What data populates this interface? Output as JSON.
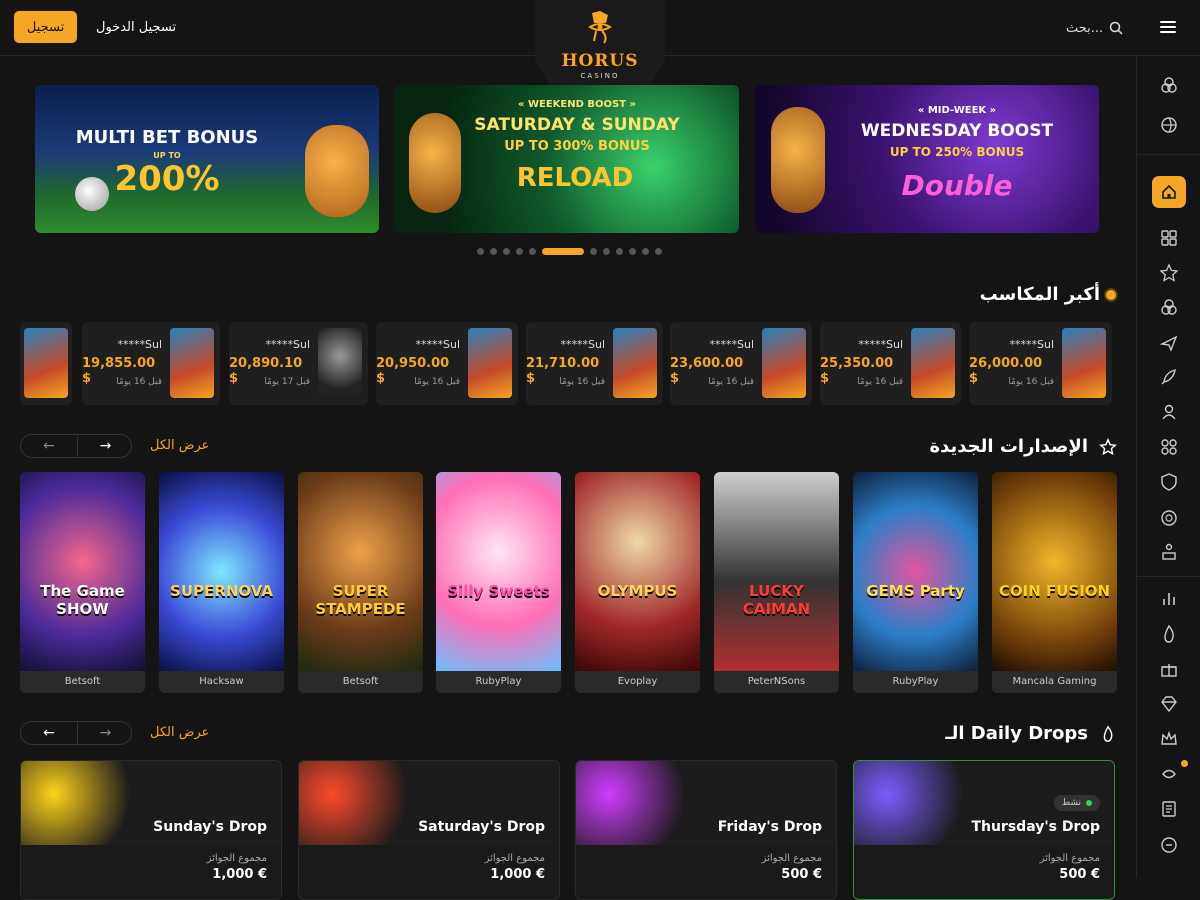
{
  "header": {
    "register_label": "تسجيل",
    "login_label": "تسجيل الدخول",
    "search_placeholder": "بحث...",
    "logo_text": "HORUS",
    "logo_sub": "CASINO"
  },
  "banners": [
    {
      "line1": "MULTI BET BONUS",
      "line2": "UP TO",
      "line3": "200%"
    },
    {
      "line1": "« WEEKEND BOOST »",
      "line2": "SATURDAY & SUNDAY",
      "line3": "UP TO 300% BONUS",
      "line4": "RELOAD"
    },
    {
      "line1": "« MID-WEEK »",
      "line2": "WEDNESDAY BOOST",
      "line3": "UP TO 250% BONUS",
      "line4": "Double"
    }
  ],
  "carousel": {
    "total": 12,
    "active": 5
  },
  "big_wins": {
    "title": "أكبر المكاسب",
    "items": [
      {
        "user": "*****Sul",
        "amount": "26,000.00 $",
        "ago": "قبل 16 يومًا"
      },
      {
        "user": "*****Sul",
        "amount": "25,350.00 $",
        "ago": "قبل 16 يومًا"
      },
      {
        "user": "*****Sul",
        "amount": "23,600.00 $",
        "ago": "قبل 16 يومًا"
      },
      {
        "user": "*****Sul",
        "amount": "21,710.00 $",
        "ago": "قبل 16 يومًا"
      },
      {
        "user": "*****Sul",
        "amount": "20,950.00 $",
        "ago": "قبل 16 يومًا"
      },
      {
        "user": "*****Sul",
        "amount": "20,890.10 $",
        "ago": "قبل 17 يومًا"
      },
      {
        "user": "*****Sul",
        "amount": "19,855.00 $",
        "ago": "قبل 16 يومًا"
      }
    ]
  },
  "new_releases": {
    "title": "الإصدارات الجديدة",
    "view_all": "عرض الكل",
    "games": [
      {
        "title": "COIN FUSION",
        "provider": "Mancala Gaming"
      },
      {
        "title": "GEMS Party",
        "provider": "RubyPlay"
      },
      {
        "title": "LUCKY CAIMAN",
        "provider": "PeterNSons"
      },
      {
        "title": "OLYMPUS",
        "provider": "Evoplay"
      },
      {
        "title": "Silly Sweets",
        "provider": "RubyPlay"
      },
      {
        "title": "SUPER STAMPEDE",
        "provider": "Betsoft"
      },
      {
        "title": "SUPERNOVA",
        "provider": "Hacksaw"
      },
      {
        "title": "The Game SHOW",
        "provider": "Betsoft"
      }
    ]
  },
  "daily_drops": {
    "title": "الـ Daily Drops",
    "view_all": "عرض الكل",
    "prize_label": "مجموع الجوائز",
    "active_label": "نشط",
    "drops": [
      {
        "name": "Thursday's Drop",
        "prize": "500 €",
        "color": "#7b5cff"
      },
      {
        "name": "Friday's Drop",
        "prize": "500 €",
        "color": "#d13cff"
      },
      {
        "name": "Saturday's Drop",
        "prize": "1,000 €",
        "color": "#ff4a2a"
      },
      {
        "name": "Sunday's Drop",
        "prize": "1,000 €",
        "color": "#ffd21a"
      }
    ]
  },
  "colors": {
    "accent": "#f5a623",
    "background": "#141414",
    "active_green": "#3ad15a"
  }
}
